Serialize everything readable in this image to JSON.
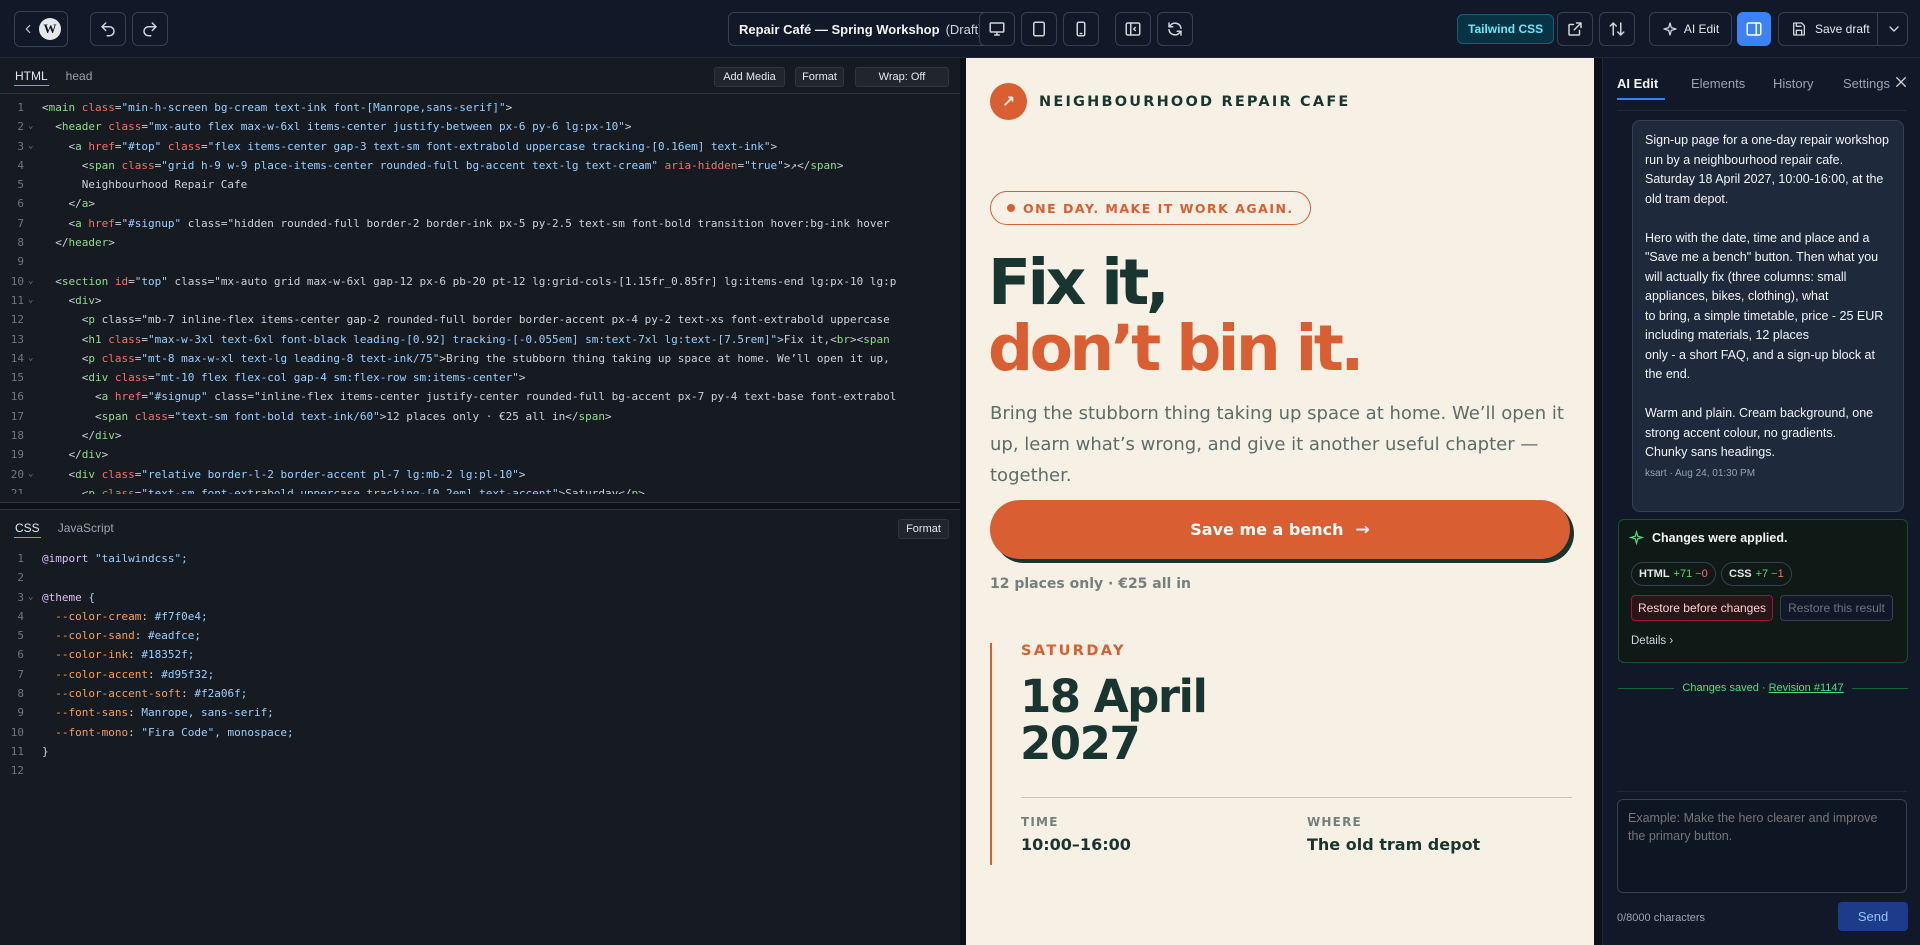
{
  "toolbar": {
    "doc_title": "Repair Café — Spring Workshop",
    "doc_status": "(Draft)",
    "tailwind_badge": "Tailwind CSS",
    "ai_edit_label": "AI Edit",
    "save_draft_label": "Save draft"
  },
  "html_editor": {
    "tabs": [
      "HTML",
      "head"
    ],
    "buttons": {
      "add_media": "Add Media",
      "format": "Format",
      "wrap": "Wrap: Off"
    },
    "lines": [
      "<main class=\"min-h-screen bg-cream text-ink font-[Manrope,sans-serif]\">",
      "  <header class=\"mx-auto flex max-w-6xl items-center justify-between px-6 py-6 lg:px-10\">",
      "    <a href=\"#top\" class=\"flex items-center gap-3 text-sm font-extrabold uppercase tracking-[0.16em] text-ink\">",
      "      <span class=\"grid h-9 w-9 place-items-center rounded-full bg-accent text-lg text-cream\" aria-hidden=\"true\">↗</span>",
      "      Neighbourhood Repair Cafe",
      "    </a>",
      "    <a href=\"#signup\" class=\"hidden rounded-full border-2 border-ink px-5 py-2.5 text-sm font-bold transition hover:bg-ink hover",
      "  </header>",
      "",
      "  <section id=\"top\" class=\"mx-auto grid max-w-6xl gap-12 px-6 pb-20 pt-12 lg:grid-cols-[1.15fr_0.85fr] lg:items-end lg:px-10 lg:p",
      "    <div>",
      "      <p class=\"mb-7 inline-flex items-center gap-2 rounded-full border border-accent px-4 py-2 text-xs font-extrabold uppercase",
      "      <h1 class=\"max-w-3xl text-6xl font-black leading-[0.92] tracking-[-0.055em] sm:text-7xl lg:text-[7.5rem]\">Fix it,<br><span",
      "      <p class=\"mt-8 max-w-xl text-lg leading-8 text-ink/75\">Bring the stubborn thing taking up space at home. We’ll open it up,",
      "      <div class=\"mt-10 flex flex-col gap-4 sm:flex-row sm:items-center\">",
      "        <a href=\"#signup\" class=\"inline-flex items-center justify-center rounded-full bg-accent px-7 py-4 text-base font-extrabol",
      "        <span class=\"text-sm font-bold text-ink/60\">12 places only · €25 all in</span>",
      "      </div>",
      "    </div>",
      "    <div class=\"relative border-l-2 border-accent pl-7 lg:mb-2 lg:pl-10\">",
      "      <p class=\"text-sm font-extrabold uppercase tracking-[0.2em] text-accent\">Saturday</p>"
    ]
  },
  "css_editor": {
    "tabs": [
      "CSS",
      "JavaScript"
    ],
    "format": "Format",
    "lines": [
      "@import \"tailwindcss\";",
      "",
      "@theme {",
      "  --color-cream: #f7f0e4;",
      "  --color-sand: #eadfce;",
      "  --color-ink: #18352f;",
      "  --color-accent: #d95f32;",
      "  --color-accent-soft: #f2a06f;",
      "  --font-sans: Manrope, sans-serif;",
      "  --font-mono: \"Fira Code\", monospace;",
      "}",
      ""
    ]
  },
  "preview": {
    "logo_arrow": "↗",
    "brand": "NEIGHBOURHOOD REPAIR CAFE",
    "pill": "ONE DAY. MAKE IT WORK AGAIN.",
    "h1_line1": "Fix it,",
    "h1_line2": "don’t bin it.",
    "lede": "Bring the stubborn thing taking up space at home. We’ll open it up, learn what’s wrong, and give it another useful chapter — together.",
    "cta": "Save me a bench",
    "cta_arrow": "→",
    "cta_note": "12 places only · €25 all in",
    "day": "SATURDAY",
    "date_line1": "18 April",
    "date_line2": "2027",
    "time_label": "TIME",
    "time_value": "10:00–16:00",
    "where_label": "WHERE",
    "where_value": "The old tram depot"
  },
  "ai_panel": {
    "tabs": [
      "AI Edit",
      "Elements",
      "History",
      "Settings"
    ],
    "message": "Sign-up page for a one-day repair workshop run by a neighbourhood repair cafe.\nSaturday 18 April 2027, 10:00-16:00, at the old tram depot.\n\nHero with the date, time and place and a \"Save me a bench\" button. Then what you will actually fix (three columns: small appliances, bikes, clothing), what\nto bring, a simple timetable, price - 25 EUR including materials, 12 places\nonly - a short FAQ, and a sign-up block at the end.\n\nWarm and plain. Cream background, one strong accent colour, no gradients.\nChunky sans headings.",
    "message_meta": "ksart · Aug 24, 01:30 PM",
    "applied_title": "Changes were applied.",
    "html_pill": {
      "label": "HTML",
      "plus": "+71",
      "minus": "−0"
    },
    "css_pill": {
      "label": "CSS",
      "plus": "+7",
      "minus": "−1"
    },
    "restore_before": "Restore before changes",
    "restore_result": "Restore this result",
    "details": "Details ›",
    "saved_text": "Changes saved · ",
    "revision": "Revision #1147",
    "placeholder": "Example: Make the hero clearer and improve the primary button.",
    "char_count": "0/8000 characters",
    "send": "Send"
  },
  "colors": {
    "cream": "#f7f0e4",
    "ink": "#18352f",
    "accent": "#d95f32",
    "app_bg": "#111827",
    "primary": "#3b82f6"
  }
}
